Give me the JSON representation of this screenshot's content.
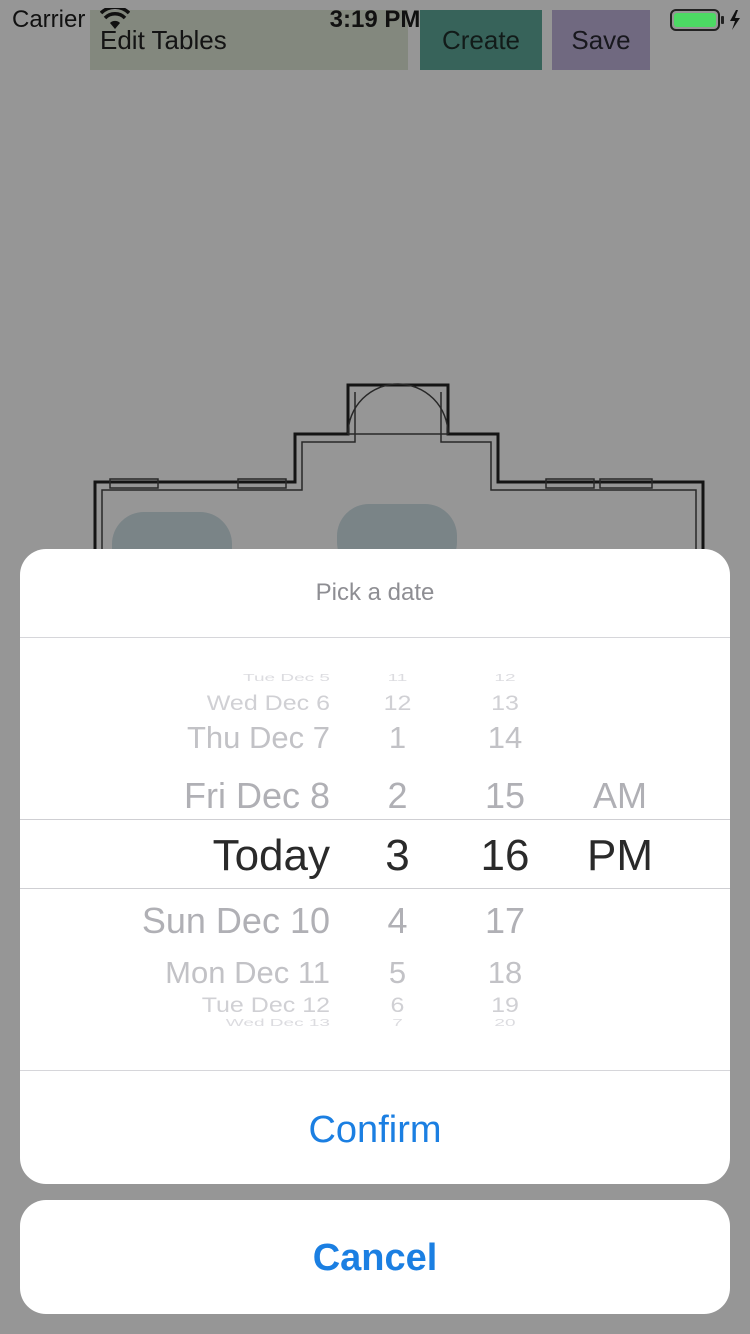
{
  "status_bar": {
    "carrier": "Carrier",
    "time": "3:19 PM",
    "battery_color": "#4cd964"
  },
  "app": {
    "title_field": "Edit Tables",
    "create_label": "Create",
    "save_label": "Save",
    "colors": {
      "title_bg": "#dfe8d6",
      "create_bg": "#5ea99a",
      "save_bg": "#bfb3da",
      "table_color": "#8aa4ad"
    }
  },
  "sheet": {
    "title": "Pick a date",
    "confirm_label": "Confirm",
    "cancel_label": "Cancel",
    "accent": "#1b7fe2"
  },
  "picker": {
    "dates": [
      "Tue Dec 5",
      "Wed Dec 6",
      "Thu Dec 7",
      "Fri Dec 8",
      "Today",
      "Sun Dec 10",
      "Mon Dec 11",
      "Tue Dec 12",
      "Wed Dec 13"
    ],
    "hours": [
      "11",
      "12",
      "1",
      "2",
      "3",
      "4",
      "5",
      "6",
      "7"
    ],
    "minutes": [
      "12",
      "13",
      "14",
      "15",
      "16",
      "17",
      "18",
      "19",
      "20"
    ],
    "periods": [
      "",
      "",
      "",
      "AM",
      "PM",
      "",
      "",
      "",
      ""
    ],
    "selected": {
      "date": "Today",
      "hour": "3",
      "minute": "16",
      "period": "PM"
    }
  }
}
